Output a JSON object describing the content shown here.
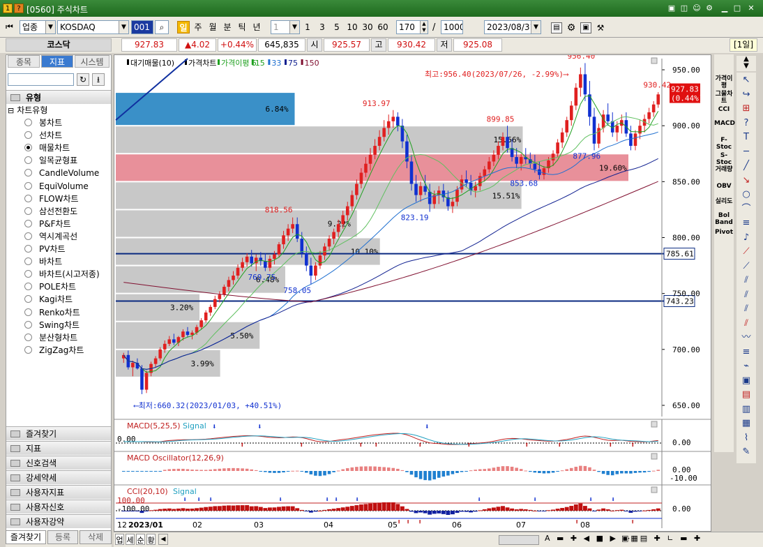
{
  "window": {
    "title": "[0560] 주식차트",
    "badge1": "1",
    "badge2": "?",
    "win_icons": [
      "▣",
      "◫",
      "☺",
      "⚙",
      "▁",
      "□",
      "✕"
    ]
  },
  "toolbar": {
    "category": "업종",
    "symbol": "KOSDAQ",
    "code": "001",
    "periods": [
      "일",
      "주",
      "월",
      "분",
      "틱",
      "년"
    ],
    "interval_select": "1",
    "intervals": [
      "1",
      "3",
      "5",
      "10",
      "30",
      "60"
    ],
    "count": "170",
    "slash": "/",
    "max": "1000",
    "date": "2023/08/31"
  },
  "quote": {
    "name": "코스닥",
    "price": "927.83",
    "change": "▲4.02",
    "change_pct": "+0.44%",
    "volume": "645,835",
    "open_label": "시",
    "open": "925.57",
    "high_label": "고",
    "high": "930.42",
    "low_label": "저",
    "low": "925.08",
    "period_badge": "[1일]"
  },
  "left_panel": {
    "tabs": [
      "종목",
      "지표",
      "시스템"
    ],
    "section_title": "유형",
    "tree_root": "차트유형",
    "chart_types": [
      "봉차트",
      "선차트",
      "매물차트",
      "일목균형표",
      "CandleVolume",
      "EquiVolume",
      "FLOW차트",
      "삼선전환도",
      "P&F차트",
      "역시계곡선",
      "PV차트",
      "바차트",
      "바차트(시고저종)",
      "POLE차트",
      "Kagi차트",
      "Renko차트",
      "Swing차트",
      "분산형차트",
      "ZigZag차트"
    ],
    "selected_type": "매물차트",
    "folders": [
      "즐겨찾기",
      "지표",
      "신호검색",
      "강세약세",
      "사용자지표",
      "사용자신호",
      "사용자강약"
    ],
    "bottom_tabs": [
      "즐겨찾기",
      "등록",
      "삭제"
    ]
  },
  "chart_data": {
    "type": "candlestick",
    "title_legend": [
      {
        "name": "대기매물(10)",
        "color": "#000000"
      },
      {
        "name": "가격차트",
        "color": "#000000"
      },
      {
        "name": "가격이평 5",
        "color": "#20a020"
      },
      {
        "name": "15",
        "color": "#20a020"
      },
      {
        "name": "33",
        "color": "#2070d0"
      },
      {
        "name": "75",
        "color": "#102090"
      },
      {
        "name": "150",
        "color": "#801030"
      }
    ],
    "colors": {
      "up": "#e02020",
      "down": "#1030d0",
      "ma5": "#20a020",
      "ma15": "#60c060",
      "ma33": "#2070d0",
      "ma75": "#102090",
      "ma150": "#801030",
      "profile": "#c8c8c8",
      "profile_blue": "#3a90c8",
      "profile_red": "#e8909a",
      "hline": "#0a2a80"
    },
    "y_axis": {
      "min": 640,
      "max": 960,
      "ticks": [
        650,
        700,
        750,
        800,
        850,
        900,
        950
      ],
      "tick_labels": [
        "650.00",
        "700.00",
        "750.00",
        "800.00",
        "850.00",
        "900.00",
        "950.00"
      ]
    },
    "x_axis": {
      "labels": [
        "12",
        "2023/01",
        "02",
        "03",
        "04",
        "05",
        "06",
        "07",
        "08"
      ]
    },
    "current_price_label": "927.83",
    "current_pct_label": "(0.44%)",
    "horizontal_lines": [
      {
        "value": 785.61,
        "label": "785.61"
      },
      {
        "value": 743.23,
        "label": "743.23"
      }
    ],
    "annotations": {
      "high_note": "최고:956.40(2023/07/26, -2.99%)⟶",
      "low_note": "⟵최저:660.32(2023/01/03, +40.51%)",
      "peaks": [
        {
          "text": "956.40",
          "value": 956.4,
          "x": 0.85,
          "color": "#e02020"
        },
        {
          "text": "930.42",
          "value": 930.42,
          "x": 0.989,
          "color": "#e02020"
        },
        {
          "text": "913.97",
          "value": 913.97,
          "x": 0.475,
          "color": "#e02020"
        },
        {
          "text": "899.85",
          "value": 899.85,
          "x": 0.702,
          "color": "#e02020"
        },
        {
          "text": "818.56",
          "value": 818.56,
          "x": 0.296,
          "color": "#e02020"
        },
        {
          "text": "877.96",
          "value": 877.96,
          "x": 0.86,
          "color": "#1030d0"
        },
        {
          "text": "853.68",
          "value": 853.68,
          "x": 0.745,
          "color": "#1030d0"
        },
        {
          "text": "823.19",
          "value": 823.19,
          "x": 0.545,
          "color": "#1030d0"
        },
        {
          "text": "769.75",
          "value": 769.75,
          "x": 0.265,
          "color": "#1030d0"
        },
        {
          "text": "758.05",
          "value": 758.05,
          "x": 0.33,
          "color": "#1030d0"
        }
      ]
    },
    "volume_profile": [
      {
        "low": 900,
        "high": 930,
        "pct": 6.84,
        "label": "6.84%",
        "color": "blue"
      },
      {
        "low": 875,
        "high": 900,
        "pct": 15.56,
        "label": "15.56%",
        "color": "gray"
      },
      {
        "low": 850,
        "high": 875,
        "pct": 19.6,
        "label": "19.60%",
        "color": "red"
      },
      {
        "low": 825,
        "high": 850,
        "pct": 15.51,
        "label": "15.51%",
        "color": "gray"
      },
      {
        "low": 800,
        "high": 825,
        "pct": 9.22,
        "label": "9.22%",
        "color": "gray"
      },
      {
        "low": 775,
        "high": 800,
        "pct": 10.1,
        "label": "10.10%",
        "color": "gray"
      },
      {
        "low": 750,
        "high": 775,
        "pct": 6.48,
        "label": "6.48%",
        "color": "gray"
      },
      {
        "low": 725,
        "high": 750,
        "pct": 3.2,
        "label": "3.20%",
        "color": "gray"
      },
      {
        "low": 700,
        "high": 725,
        "pct": 5.5,
        "label": "5.50%",
        "color": "gray"
      },
      {
        "low": 675,
        "high": 700,
        "pct": 3.99,
        "label": "3.99%",
        "color": "gray"
      }
    ],
    "candles": [
      [
        692,
        697,
        688,
        695
      ],
      [
        695,
        699,
        682,
        684
      ],
      [
        684,
        690,
        676,
        688
      ],
      [
        688,
        692,
        682,
        683
      ],
      [
        683,
        686,
        660,
        664
      ],
      [
        664,
        681,
        661,
        679
      ],
      [
        679,
        689,
        676,
        687
      ],
      [
        687,
        694,
        684,
        692
      ],
      [
        692,
        702,
        690,
        700
      ],
      [
        700,
        708,
        697,
        705
      ],
      [
        705,
        712,
        703,
        709
      ],
      [
        709,
        714,
        704,
        706
      ],
      [
        706,
        712,
        703,
        711
      ],
      [
        711,
        718,
        708,
        716
      ],
      [
        716,
        720,
        711,
        713
      ],
      [
        713,
        717,
        709,
        715
      ],
      [
        715,
        722,
        713,
        720
      ],
      [
        720,
        728,
        718,
        726
      ],
      [
        726,
        735,
        724,
        733
      ],
      [
        733,
        740,
        730,
        738
      ],
      [
        738,
        748,
        736,
        745
      ],
      [
        745,
        752,
        742,
        749
      ],
      [
        749,
        758,
        747,
        756
      ],
      [
        756,
        765,
        752,
        762
      ],
      [
        762,
        770,
        758,
        766
      ],
      [
        766,
        776,
        763,
        773
      ],
      [
        773,
        782,
        770,
        778
      ],
      [
        778,
        786,
        774,
        783
      ],
      [
        783,
        789,
        774,
        777
      ],
      [
        777,
        785,
        770,
        782
      ],
      [
        782,
        787,
        775,
        779
      ],
      [
        779,
        786,
        770,
        773
      ],
      [
        773,
        784,
        770,
        781
      ],
      [
        781,
        788,
        776,
        785
      ],
      [
        785,
        796,
        782,
        794
      ],
      [
        794,
        806,
        790,
        802
      ],
      [
        802,
        812,
        797,
        808
      ],
      [
        808,
        818,
        804,
        812
      ],
      [
        812,
        818,
        796,
        799
      ],
      [
        799,
        805,
        782,
        786
      ],
      [
        786,
        792,
        770,
        775
      ],
      [
        775,
        782,
        758,
        766
      ],
      [
        766,
        778,
        762,
        775
      ],
      [
        775,
        788,
        772,
        784
      ],
      [
        784,
        795,
        780,
        792
      ],
      [
        792,
        802,
        788,
        799
      ],
      [
        799,
        808,
        794,
        805
      ],
      [
        805,
        816,
        800,
        812
      ],
      [
        812,
        824,
        808,
        820
      ],
      [
        820,
        832,
        815,
        828
      ],
      [
        828,
        842,
        824,
        838
      ],
      [
        838,
        852,
        834,
        848
      ],
      [
        848,
        862,
        844,
        858
      ],
      [
        858,
        872,
        854,
        866
      ],
      [
        866,
        880,
        860,
        874
      ],
      [
        874,
        888,
        870,
        882
      ],
      [
        882,
        896,
        878,
        890
      ],
      [
        890,
        905,
        886,
        898
      ],
      [
        898,
        910,
        892,
        904
      ],
      [
        904,
        914,
        898,
        908
      ],
      [
        908,
        912,
        895,
        900
      ],
      [
        900,
        906,
        880,
        886
      ],
      [
        886,
        892,
        862,
        868
      ],
      [
        868,
        874,
        842,
        848
      ],
      [
        848,
        856,
        832,
        838
      ],
      [
        838,
        850,
        832,
        846
      ],
      [
        846,
        856,
        838,
        841
      ],
      [
        841,
        848,
        823,
        830
      ],
      [
        830,
        842,
        826,
        838
      ],
      [
        838,
        846,
        830,
        842
      ],
      [
        842,
        848,
        832,
        836
      ],
      [
        836,
        842,
        824,
        828
      ],
      [
        828,
        836,
        822,
        832
      ],
      [
        832,
        846,
        828,
        843
      ],
      [
        843,
        856,
        840,
        852
      ],
      [
        852,
        860,
        845,
        849
      ],
      [
        849,
        856,
        838,
        842
      ],
      [
        842,
        850,
        836,
        846
      ],
      [
        846,
        858,
        842,
        855
      ],
      [
        855,
        864,
        850,
        861
      ],
      [
        861,
        872,
        858,
        868
      ],
      [
        868,
        878,
        864,
        874
      ],
      [
        874,
        886,
        870,
        882
      ],
      [
        882,
        894,
        878,
        890
      ],
      [
        890,
        900,
        876,
        880
      ],
      [
        880,
        888,
        868,
        872
      ],
      [
        872,
        880,
        862,
        866
      ],
      [
        866,
        875,
        860,
        872
      ],
      [
        872,
        880,
        866,
        870
      ],
      [
        870,
        876,
        862,
        866
      ],
      [
        866,
        874,
        858,
        861
      ],
      [
        861,
        868,
        852,
        856
      ],
      [
        856,
        864,
        852,
        862
      ],
      [
        862,
        872,
        858,
        869
      ],
      [
        869,
        878,
        864,
        875
      ],
      [
        875,
        888,
        872,
        885
      ],
      [
        885,
        898,
        880,
        894
      ],
      [
        894,
        908,
        890,
        905
      ],
      [
        905,
        922,
        900,
        918
      ],
      [
        918,
        938,
        914,
        934
      ],
      [
        934,
        952,
        926,
        946
      ],
      [
        946,
        956,
        922,
        928
      ],
      [
        928,
        940,
        900,
        908
      ],
      [
        908,
        916,
        878,
        884
      ],
      [
        884,
        902,
        880,
        898
      ],
      [
        898,
        914,
        894,
        910
      ],
      [
        910,
        920,
        900,
        904
      ],
      [
        904,
        912,
        890,
        894
      ],
      [
        894,
        904,
        886,
        900
      ],
      [
        900,
        910,
        893,
        905
      ],
      [
        905,
        912,
        890,
        893
      ],
      [
        893,
        900,
        878,
        882
      ],
      [
        882,
        896,
        878,
        893
      ],
      [
        893,
        905,
        888,
        900
      ],
      [
        900,
        910,
        894,
        906
      ],
      [
        906,
        916,
        902,
        912
      ],
      [
        912,
        922,
        908,
        919
      ],
      [
        919,
        930,
        916,
        928
      ]
    ],
    "panels": [
      {
        "title": "MACD(5,25,5)",
        "signal_label": "Signal",
        "zero_label": "0.00",
        "axis_label": "0.00"
      },
      {
        "title": "MACD Oscillator(12,26,9)",
        "axis_labels": [
          "0.00",
          "-10.00"
        ]
      },
      {
        "title": "CCI(20,10)",
        "signal_label": "Signal",
        "level_top": "100.00",
        "level_bottom": "-100.00",
        "axis_label": "0.00"
      }
    ]
  },
  "right_panel": {
    "indicator_buttons": [
      "가격이평",
      "그물차트",
      "CCI",
      "MACD",
      "F-Stoc",
      "S-Stoc",
      "거래량",
      "OBV",
      "실리도",
      "Bol Band",
      "Pivot"
    ]
  },
  "bottom_bar": {
    "tabs": [
      "업",
      "세",
      "순",
      "황"
    ]
  }
}
